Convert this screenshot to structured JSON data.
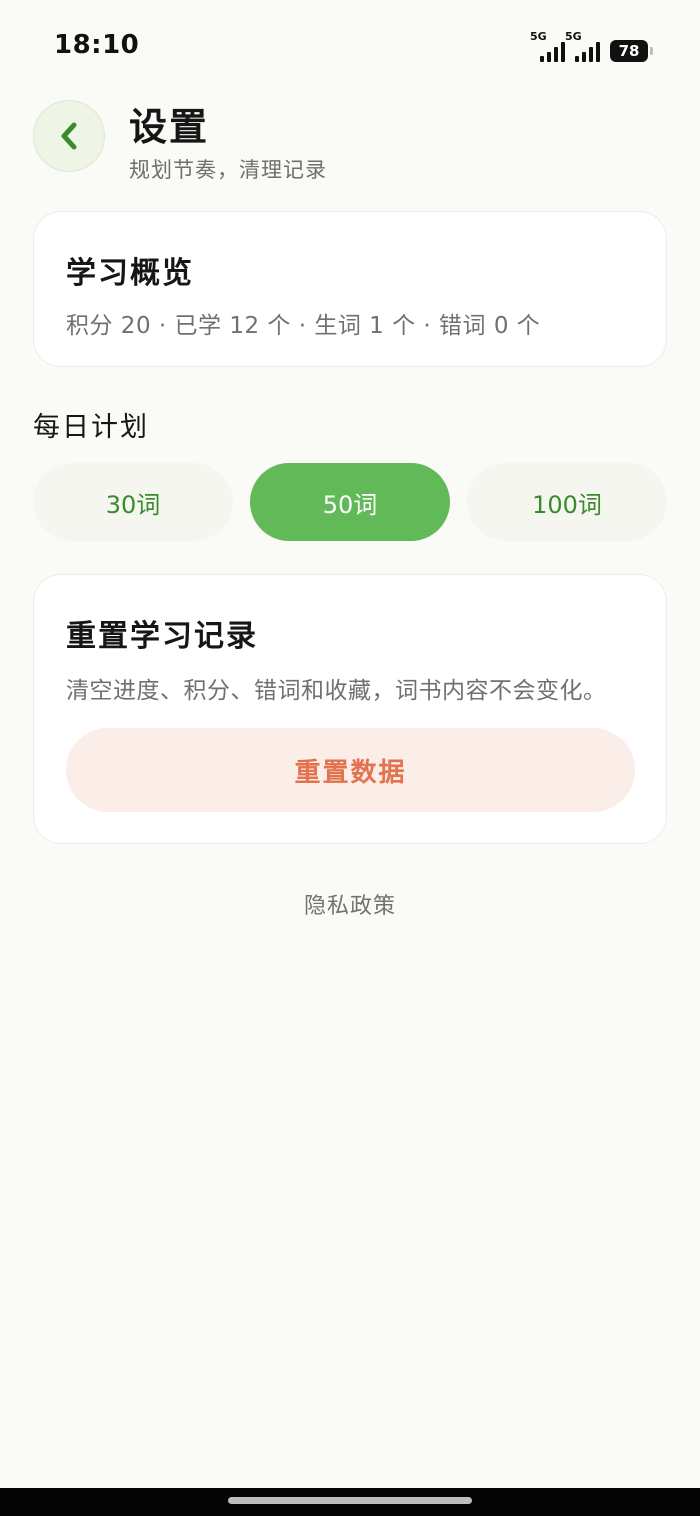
{
  "status_bar": {
    "time": "18:10",
    "signal1_label": "5G",
    "signal2_label": "5G",
    "battery": "78"
  },
  "header": {
    "title": "设置",
    "subtitle": "规划节奏，清理记录",
    "back_icon": "chevron-left-icon"
  },
  "overview": {
    "title": "学习概览",
    "stats": "积分 20 · 已学 12 个 · 生词 1 个 · 错词 0 个"
  },
  "daily_plan": {
    "label": "每日计划",
    "options": [
      {
        "label": "30词",
        "selected": false
      },
      {
        "label": "50词",
        "selected": true
      },
      {
        "label": "100词",
        "selected": false
      }
    ]
  },
  "reset": {
    "title": "重置学习记录",
    "description": "清空进度、积分、错词和收藏，词书内容不会变化。",
    "button_label": "重置数据"
  },
  "footer": {
    "privacy_label": "隐私政策"
  },
  "colors": {
    "accent": "#62b957",
    "accent_text": "#3b8a2e",
    "danger": "#e2734e",
    "danger_bg": "#fbeee8",
    "background": "#fafbf6"
  }
}
